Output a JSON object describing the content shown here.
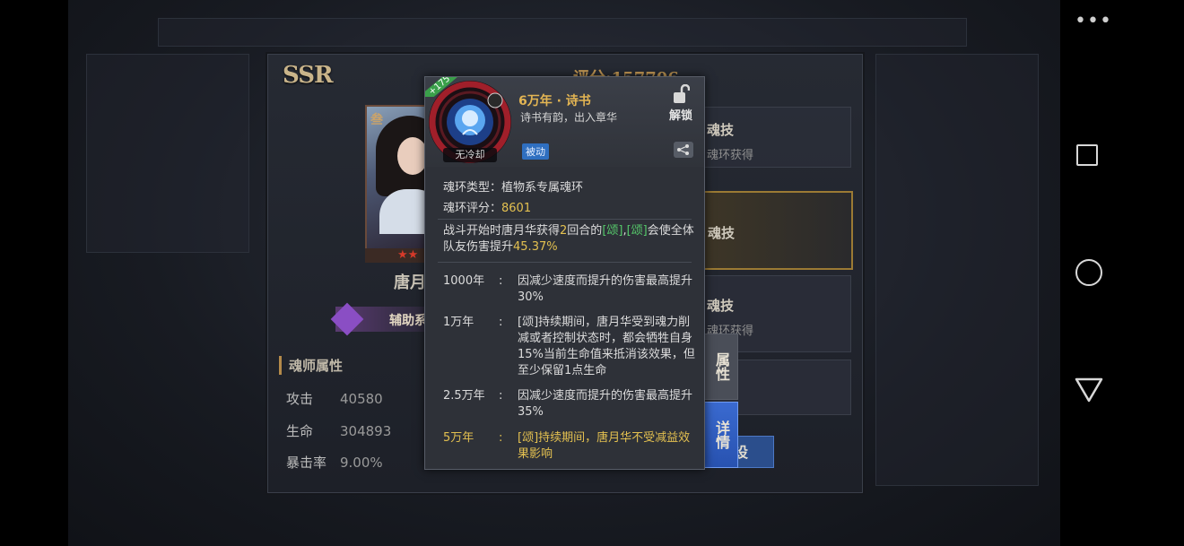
{
  "system": {
    "menu_dots": "•••"
  },
  "background": {
    "ssr_label": "SSR",
    "score_text": "评分:157706",
    "hero_name": "唐月华",
    "role_label": "辅助系",
    "card_rank": "叁",
    "stars": "★★",
    "attributes_title": "魂师属性",
    "attributes": [
      {
        "key": "攻击",
        "value": "40580"
      },
      {
        "key": "生命",
        "value": "304893"
      },
      {
        "key": "暴击率",
        "value": "9.00%"
      }
    ],
    "skill_slots": [
      {
        "title": "魂技",
        "sub": "魂环获得"
      },
      {
        "title": "魂技",
        "sub": ""
      },
      {
        "title": "魂技",
        "sub": "魂环获得"
      }
    ],
    "tab_attributes": "属性",
    "tab_details": "详情",
    "bottom_button": "设"
  },
  "popup": {
    "plus_badge": "+175",
    "no_cooldown": "无冷却",
    "ring_year_name": "6万年 · 诗书",
    "ring_desc": "诗书有韵，出入章华",
    "unlock_label": "解锁",
    "passive_tag": "被动",
    "type_label": "魂环类型：",
    "type_value": "植物系专属魂环",
    "score_label": "魂环评分：",
    "score_value": "8601",
    "effect_pre": "战斗开始时唐月华获得",
    "effect_num": "2",
    "effect_mid1": "回合的",
    "effect_tag1": "[颂]",
    "effect_comma": ",",
    "effect_tag2": "[颂]",
    "effect_mid2": "会使全体队友伤害提升",
    "effect_pct": "45.37%",
    "year_effects": [
      {
        "year": "1000年",
        "colon": ":",
        "desc": "因减少速度而提升的伤害最高提升30%"
      },
      {
        "year": "1万年",
        "colon": ":",
        "desc": "[颂]持续期间，唐月华受到魂力削减或者控制状态时，都会牺牲自身15%当前生命值来抵消该效果，但至少保留1点生命"
      },
      {
        "year": "2.5万年",
        "colon": ":",
        "desc": "因减少速度而提升的伤害最高提升35%"
      },
      {
        "year": "5万年",
        "colon": ":",
        "desc": "[颂]持续期间，唐月华不受减益效果影响"
      }
    ]
  },
  "colors": {
    "gold": "#e3c050",
    "green": "#55c86a",
    "tab_blue": "#2f5fc0"
  }
}
